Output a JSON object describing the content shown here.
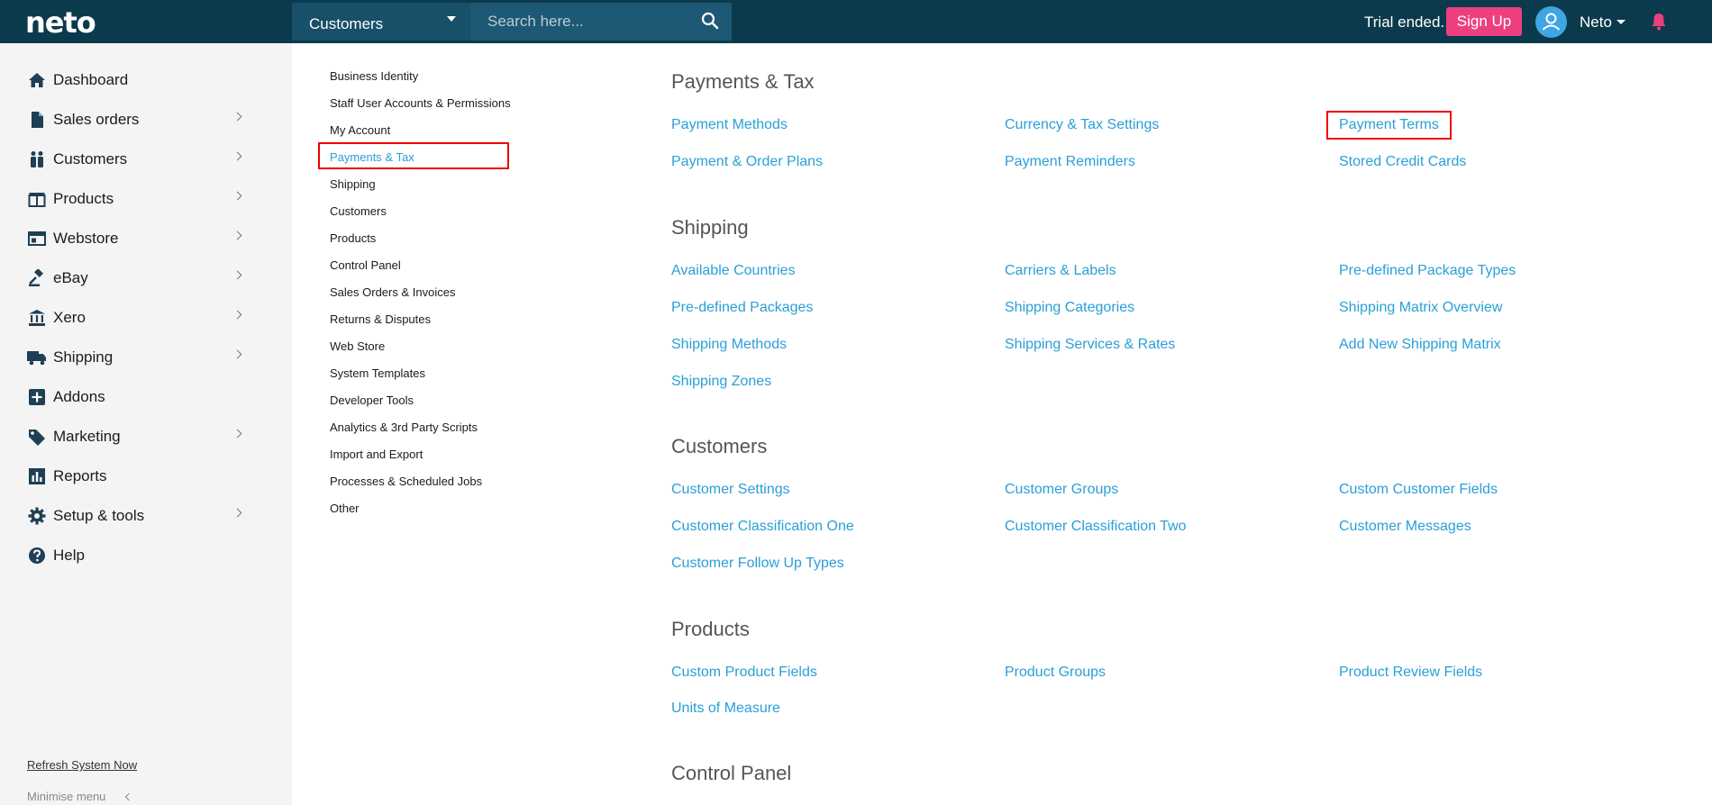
{
  "header": {
    "logo": "neto",
    "scope": "Customers",
    "search_placeholder": "Search here...",
    "trial_text": "Trial ended.",
    "signup": "Sign Up",
    "user": "Neto",
    "colors": {
      "bar": "#0b3a4d",
      "signup": "#ec3f7f",
      "bell": "#ec3f7f",
      "link": "#2a9fd8"
    }
  },
  "sidebar": {
    "items": [
      {
        "label": "Dashboard",
        "icon": "home-icon",
        "chevron": false
      },
      {
        "label": "Sales orders",
        "icon": "document-icon",
        "chevron": true
      },
      {
        "label": "Customers",
        "icon": "people-icon",
        "chevron": true
      },
      {
        "label": "Products",
        "icon": "box-icon",
        "chevron": true
      },
      {
        "label": "Webstore",
        "icon": "browser-icon",
        "chevron": true
      },
      {
        "label": "eBay",
        "icon": "gavel-icon",
        "chevron": true
      },
      {
        "label": "Xero",
        "icon": "bank-icon",
        "chevron": true
      },
      {
        "label": "Shipping",
        "icon": "truck-icon",
        "chevron": true
      },
      {
        "label": "Addons",
        "icon": "plus-square-icon",
        "chevron": false
      },
      {
        "label": "Marketing",
        "icon": "tag-icon",
        "chevron": true
      },
      {
        "label": "Reports",
        "icon": "bar-chart-icon",
        "chevron": false
      },
      {
        "label": "Setup & tools",
        "icon": "gear-icon",
        "chevron": true
      },
      {
        "label": "Help",
        "icon": "question-circle-icon",
        "chevron": false
      }
    ],
    "refresh": "Refresh System Now",
    "minimise": "Minimise menu"
  },
  "submenu": {
    "items": [
      "Business Identity",
      "Staff User Accounts & Permissions",
      "My Account",
      "Payments & Tax",
      "Shipping",
      "Customers",
      "Products",
      "Control Panel",
      "Sales Orders & Invoices",
      "Returns & Disputes",
      "Web Store",
      "System Templates",
      "Developer Tools",
      "Analytics & 3rd Party Scripts",
      "Import and Export",
      "Processes & Scheduled Jobs",
      "Other"
    ],
    "active": "Payments & Tax"
  },
  "sections": [
    {
      "title": "Payments & Tax",
      "links": [
        "Payment Methods",
        "Currency & Tax Settings",
        "Payment Terms",
        "Payment & Order Plans",
        "Payment Reminders",
        "Stored Credit Cards"
      ]
    },
    {
      "title": "Shipping",
      "links": [
        "Available Countries",
        "Carriers & Labels",
        "Pre-defined Package Types",
        "Pre-defined Packages",
        "Shipping Categories",
        "Shipping Matrix Overview",
        "Shipping Methods",
        "Shipping Services & Rates",
        "Add New Shipping Matrix",
        "Shipping Zones"
      ]
    },
    {
      "title": "Customers",
      "links": [
        "Customer Settings",
        "Customer Groups",
        "Custom Customer Fields",
        "Customer Classification One",
        "Customer Classification Two",
        "Customer Messages",
        "Customer Follow Up Types"
      ]
    },
    {
      "title": "Products",
      "links": [
        "Custom Product Fields",
        "Product Groups",
        "Product Review Fields",
        "Units of Measure"
      ]
    },
    {
      "title": "Control Panel",
      "links": []
    }
  ]
}
